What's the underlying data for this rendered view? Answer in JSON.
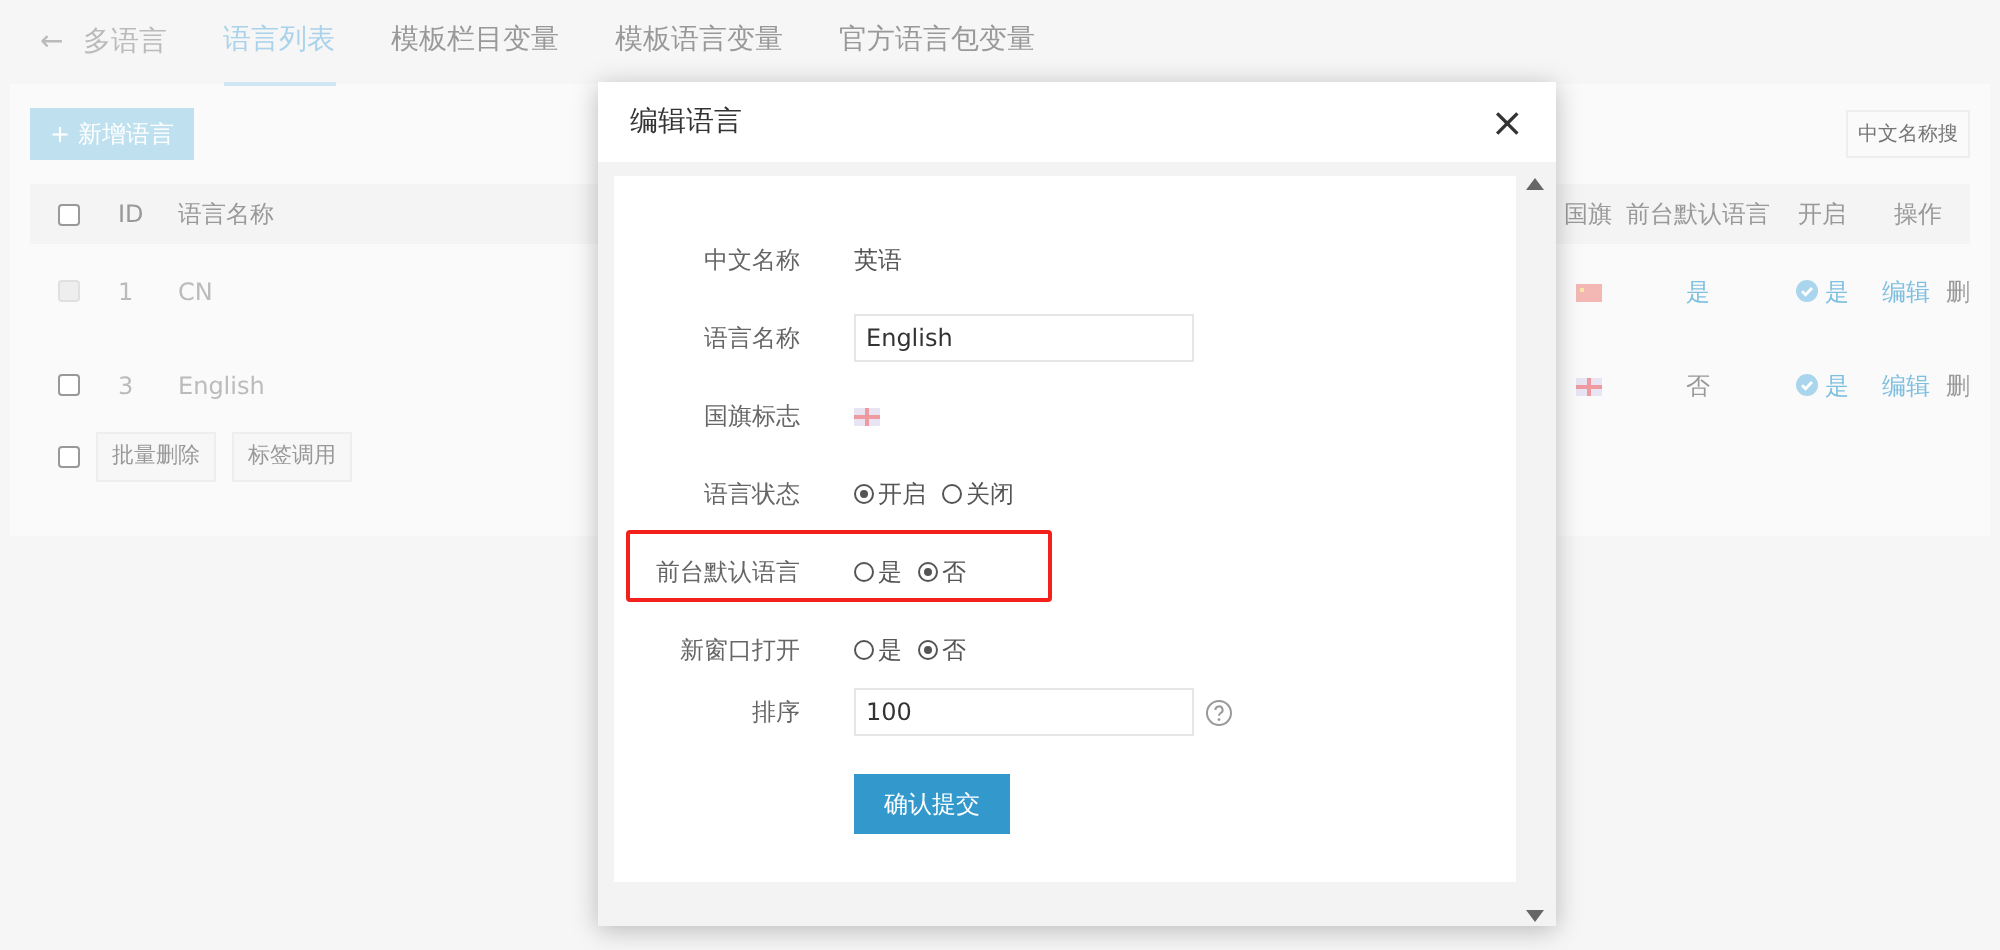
{
  "header": {
    "back": "←",
    "title": "多语言"
  },
  "tabs": [
    {
      "label": "语言列表",
      "selected": true
    },
    {
      "label": "模板栏目变量",
      "selected": false
    },
    {
      "label": "模板语言变量",
      "selected": false
    },
    {
      "label": "官方语言包变量",
      "selected": false
    }
  ],
  "add_button": "+ 新增语言",
  "search": {
    "placeholder": "中文名称搜"
  },
  "table": {
    "columns_left": [
      "ID",
      "语言名称"
    ],
    "columns_right": [
      "国旗",
      "前台默认语言",
      "开启",
      "操作"
    ],
    "header_checkbox": {
      "checked": false
    },
    "rows": [
      {
        "checked": false,
        "id": "1",
        "name": "CN",
        "flag": {
          "kind": "cn"
        },
        "default": {
          "text": "是",
          "on": true
        },
        "enabled": {
          "text": "是",
          "on": true
        },
        "actions": [
          "编辑",
          "删"
        ],
        "checkbox_disabled": true
      },
      {
        "checked": false,
        "id": "3",
        "name": "English",
        "flag": {
          "kind": "uk"
        },
        "default": {
          "text": "否",
          "on": false
        },
        "enabled": {
          "text": "是",
          "on": true
        },
        "actions": [
          "编辑",
          "删"
        ],
        "checkbox_disabled": false
      }
    ]
  },
  "footer_checkbox": {
    "checked": false
  },
  "footer_buttons": [
    "批量删除",
    "标签调用"
  ],
  "modal": {
    "title": "编辑语言",
    "close": "×",
    "fields": [
      {
        "kind": "text",
        "label": "中文名称",
        "value": "英语"
      },
      {
        "kind": "input",
        "label": "语言名称",
        "value": "English"
      },
      {
        "kind": "flag",
        "label": "国旗标志",
        "flag": {
          "kind": "uk"
        }
      },
      {
        "kind": "radio",
        "label": "语言状态",
        "options": [
          {
            "label": "开启",
            "selected": true
          },
          {
            "label": "关闭",
            "selected": false
          }
        ]
      },
      {
        "kind": "radio",
        "label": "前台默认语言",
        "highlighted": true,
        "options": [
          {
            "label": "是",
            "selected": false
          },
          {
            "label": "否",
            "selected": true
          }
        ]
      },
      {
        "kind": "radio",
        "label": "新窗口打开",
        "options": [
          {
            "label": "是",
            "selected": false
          },
          {
            "label": "否",
            "selected": true
          }
        ]
      },
      {
        "kind": "input",
        "label": "排序",
        "value": "100",
        "help": true
      }
    ],
    "submit": "确认提交"
  }
}
